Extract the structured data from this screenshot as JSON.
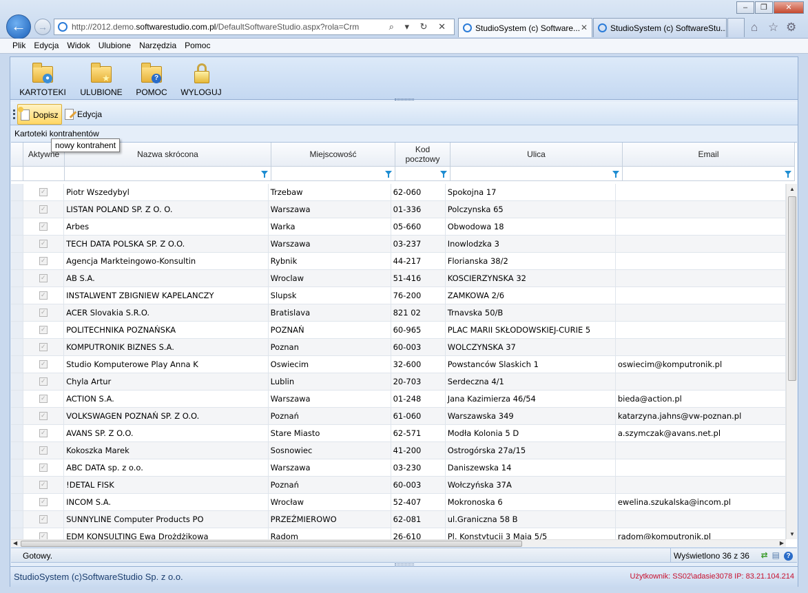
{
  "browser": {
    "address": "http://2012.demo.",
    "address_domain": "softwarestudio.com.pl",
    "address_path": "/DefaultSoftwareStudio.aspx?rola=Crm",
    "tabs": [
      {
        "label": "StudioSystem (c) Software...",
        "active": true
      },
      {
        "label": "StudioSystem (c) SoftwareStu...",
        "active": false
      }
    ],
    "window_buttons": [
      "–",
      "❐",
      "✕"
    ],
    "address_tools": "⌕ ▾ ↻ ✕",
    "chrome_icons": [
      "⌂",
      "☆",
      "⚙"
    ]
  },
  "menu": [
    "Plik",
    "Edycja",
    "Widok",
    "Ulubione",
    "Narzędzia",
    "Pomoc"
  ],
  "ribbon": [
    {
      "label": "KARTOTEKI",
      "icon": "folder-users-icon"
    },
    {
      "label": "ULUBIONE",
      "icon": "folder-star-icon"
    },
    {
      "label": "POMOC",
      "icon": "folder-help-icon"
    },
    {
      "label": "WYLOGUJ",
      "icon": "lock-icon"
    }
  ],
  "toolbar": {
    "add_label": "Dopisz",
    "edit_label": "Edycja",
    "tooltip": "nowy kontrahent"
  },
  "section_title": "Kartoteki kontrahentów",
  "grid": {
    "columns": [
      "Aktywne",
      "Nazwa skrócona",
      "Miejscowość",
      "Kod pocztowy",
      "Ulica",
      "Email"
    ],
    "rows": [
      [
        "✓",
        "Piotr Wszedybyl",
        "Trzebaw",
        "62-060",
        "Spokojna 17",
        ""
      ],
      [
        "✓",
        "LISTAN POLAND SP. Z O. O.",
        "Warszawa",
        "01-336",
        "Polczynska 65",
        ""
      ],
      [
        "✓",
        "Arbes",
        "Warka",
        "05-660",
        "Obwodowa 18",
        ""
      ],
      [
        "✓",
        "TECH DATA POLSKA SP. Z O.O.",
        "Warszawa",
        "03-237",
        "Inowlodzka 3",
        ""
      ],
      [
        "✓",
        "Agencja Markteingowo-Konsultin",
        "Rybnik",
        "44-217",
        "Florianska 38/2",
        ""
      ],
      [
        "✓",
        "AB S.A.",
        "Wroclaw",
        "51-416",
        "KOSCIERZYNSKA 32",
        ""
      ],
      [
        "✓",
        "INSTALWENT ZBIGNIEW KAPELANCZY",
        "Slupsk",
        "76-200",
        "ZAMKOWA 2/6",
        ""
      ],
      [
        "✓",
        "ACER Slovakia S.R.O.",
        "Bratislava",
        "821 02",
        "Trnavska 50/B",
        ""
      ],
      [
        "✓",
        "POLITECHNIKA POZNAŃSKA",
        "POZNAŃ",
        "60-965",
        "PLAC MARII SKŁODOWSKIEJ-CURIE 5",
        ""
      ],
      [
        "✓",
        "KOMPUTRONIK BIZNES S.A.",
        "Poznan",
        "60-003",
        "WOLCZYNSKA 37",
        ""
      ],
      [
        "✓",
        "Studio Komputerowe Play Anna K",
        "Oswiecim",
        "32-600",
        "Powstanców Slaskich 1",
        "oswiecim@komputronik.pl"
      ],
      [
        "✓",
        "Chyla Artur",
        "Lublin",
        "20-703",
        "Serdeczna 4/1",
        ""
      ],
      [
        "✓",
        "ACTION S.A.",
        "Warszawa",
        "01-248",
        "Jana Kazimierza 46/54",
        "bieda@action.pl"
      ],
      [
        "✓",
        "VOLKSWAGEN POZNAŃ SP. Z O.O.",
        "Poznań",
        "61-060",
        "Warszawska 349",
        "katarzyna.jahns@vw-poznan.pl"
      ],
      [
        "✓",
        "AVANS SP. Z O.O.",
        "Stare Miasto",
        "62-571",
        "Modła Kolonia 5 D",
        "a.szymczak@avans.net.pl"
      ],
      [
        "✓",
        "Kokoszka Marek",
        "Sosnowiec",
        "41-200",
        "Ostrogórska 27a/15",
        ""
      ],
      [
        "✓",
        "ABC DATA sp. z o.o.",
        "Warszawa",
        "03-230",
        "Daniszewska 14",
        ""
      ],
      [
        "✓",
        "!DETAL FISK",
        "Poznań",
        "60-003",
        "Wołczyńska 37A",
        ""
      ],
      [
        "✓",
        "INCOM S.A.",
        "Wrocław",
        "52-407",
        "Mokronoska 6",
        "ewelina.szukalska@incom.pl"
      ],
      [
        "✓",
        "SUNNYLINE Computer Products PO",
        "PRZEŹMIEROWO",
        "62-081",
        "ul.Graniczna 58 B",
        ""
      ],
      [
        "✓",
        "EDM KONSULTING Ewa Drożdżikowa",
        "Radom",
        "26-610",
        "Pl. Konstytucji 3 Maja 5/5",
        "radom@komputronik.pl"
      ]
    ]
  },
  "status": {
    "left": "Gotowy.",
    "right": "Wyświetlono 36 z 36"
  },
  "footer": {
    "company": "StudioSystem (c)SoftwareStudio Sp. z o.o.",
    "user": "Użytkownik: SS02\\adasie3078 IP: 83.21.104.214"
  }
}
